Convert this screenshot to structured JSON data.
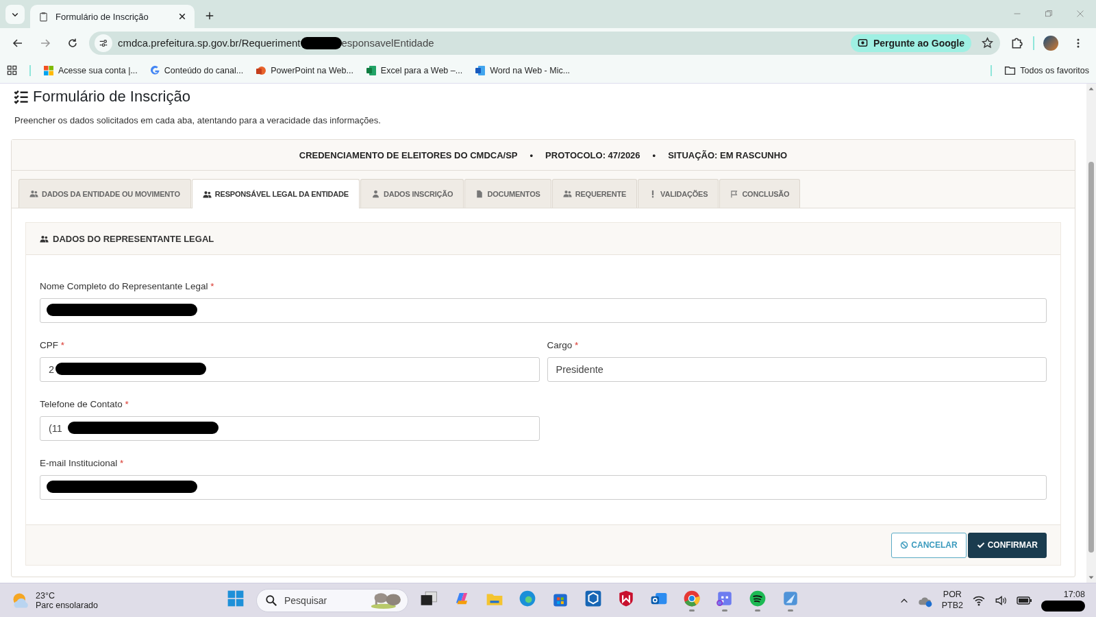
{
  "browser": {
    "tab_title": "Formulário de Inscrição",
    "url_start": "cmdca.prefeitura.sp.gov.br/Requeriment",
    "url_end": "esponsavelEntidade",
    "ask_google": "Pergunte ao Google",
    "bookmarks": [
      "Acesse sua conta |...",
      "Conteúdo do canal...",
      "PowerPoint na Web...",
      "Excel para a Web –...",
      "Word na Web - Mic..."
    ],
    "all_bookmarks": "Todos os favoritos"
  },
  "page": {
    "title": "Formulário de Inscrição",
    "subtitle": "Preencher os dados solicitados em cada aba, atentando para a veracidade das informações.",
    "header": [
      "CREDENCIAMENTO DE ELEITORES DO CMDCA/SP",
      "•",
      "PROTOCOLO: 47/2026",
      "•",
      "SITUAÇÃO: EM RASCUNHO"
    ],
    "tabs": [
      {
        "label": "DADOS DA ENTIDADE OU MOVIMENTO",
        "selected": false
      },
      {
        "label": "RESPONSÁVEL LEGAL DA ENTIDADE",
        "selected": true
      },
      {
        "label": "DADOS INSCRIÇÃO",
        "selected": false
      },
      {
        "label": "DOCUMENTOS",
        "selected": false
      },
      {
        "label": "REQUERENTE",
        "selected": false
      },
      {
        "label": "VALIDAÇÕES",
        "selected": false
      },
      {
        "label": "CONCLUSÃO",
        "selected": false
      }
    ],
    "section_title": "DADOS DO REPRESENTANTE LEGAL",
    "rows": [
      [
        {
          "label": "Nome Completo do Representante Legal",
          "required_mark": "*",
          "redacted": true
        }
      ],
      [
        {
          "label": "CPF",
          "required_mark": "*",
          "value": "2",
          "redacted": true
        },
        {
          "label": "Cargo",
          "required_mark": "*",
          "value": "Presidente"
        }
      ],
      [
        {
          "label": "Telefone de Contato",
          "required_mark": "*",
          "value": "(11",
          "redacted": true
        }
      ],
      [
        {
          "label": "E-mail Institucional",
          "required_mark": "*",
          "redacted": true
        }
      ]
    ],
    "buttons": [
      {
        "label": "CANCELAR",
        "kind": "outline"
      },
      {
        "label": "CONFIRMAR",
        "kind": "primary"
      }
    ]
  },
  "taskbar": {
    "temperature": "23°C",
    "weather": "Parc ensolarado",
    "search_placeholder": "Pesquisar",
    "apps": [
      {
        "running": false
      },
      {
        "running": false
      },
      {
        "running": false
      },
      {
        "running": false
      },
      {
        "running": false
      },
      {
        "running": false
      },
      {
        "running": false
      },
      {
        "running": false
      },
      {
        "running": false
      },
      {
        "running": true
      },
      {
        "running": true
      },
      {
        "running": true
      },
      {
        "running": true
      }
    ],
    "language": "POR",
    "layout": "PTB2",
    "time": "17:08"
  }
}
